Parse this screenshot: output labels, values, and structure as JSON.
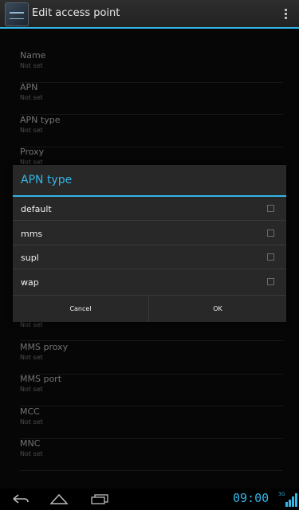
{
  "action_bar": {
    "title": "Edit access point"
  },
  "settings": {
    "items": [
      {
        "label": "Name",
        "value": "Not set"
      },
      {
        "label": "APN",
        "value": "Not set"
      },
      {
        "label": "APN type",
        "value": "Not set"
      },
      {
        "label": "Proxy",
        "value": "Not set"
      }
    ],
    "items_below": [
      {
        "label": "",
        "value": "Not set"
      },
      {
        "label": "MMS proxy",
        "value": "Not set"
      },
      {
        "label": "MMS port",
        "value": "Not set"
      },
      {
        "label": "MCC",
        "value": "Not set"
      },
      {
        "label": "MNC",
        "value": "Not set"
      }
    ]
  },
  "dialog": {
    "title": "APN type",
    "options": [
      {
        "label": "default",
        "checked": false
      },
      {
        "label": "mms",
        "checked": false
      },
      {
        "label": "supl",
        "checked": false
      },
      {
        "label": "wap",
        "checked": false
      }
    ],
    "cancel_label": "Cancel",
    "ok_label": "OK"
  },
  "status_bar": {
    "time": "09:00",
    "network": "3G"
  },
  "icons": {
    "app": "access-point-icon",
    "overflow": "overflow-menu-icon",
    "back": "back-icon",
    "home": "home-icon",
    "recent": "recent-apps-icon",
    "signal": "signal-icon"
  },
  "colors": {
    "accent": "#33b5e5",
    "background": "#0b0b0b",
    "dialog": "#282828"
  }
}
